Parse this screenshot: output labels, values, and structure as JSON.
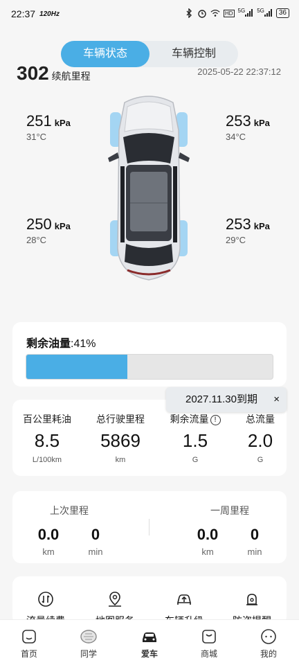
{
  "status_bar": {
    "time": "22:37",
    "refresh_rate": "120Hz",
    "network_1": "5G",
    "network_2": "5G",
    "battery": "36"
  },
  "tabs": [
    {
      "label": "车辆状态",
      "active": true
    },
    {
      "label": "车辆控制",
      "active": false
    }
  ],
  "header": {
    "range_value_partial": "302",
    "range_label": "续航里程",
    "timestamp": "2025-05-22 22:37:12"
  },
  "tires": {
    "front_left": {
      "pressure": "251",
      "unit": "kPa",
      "temp": "31°C"
    },
    "front_right": {
      "pressure": "253",
      "unit": "kPa",
      "temp": "34°C"
    },
    "rear_left": {
      "pressure": "250",
      "unit": "kPa",
      "temp": "28°C"
    },
    "rear_right": {
      "pressure": "253",
      "unit": "kPa",
      "temp": "29°C"
    }
  },
  "fuel": {
    "label": "剩余油量",
    "value": ":41%",
    "percent": 41,
    "color": "#4aaee5"
  },
  "expiry_badge": {
    "text": "2027.11.30到期",
    "close": "×"
  },
  "stats": [
    {
      "label": "百公里耗油",
      "value": "8.5",
      "unit": "L/100km"
    },
    {
      "label": "总行驶里程",
      "value": "5869",
      "unit": "km"
    },
    {
      "label": "剩余流量",
      "value": "1.5",
      "unit": "G",
      "info": "!"
    },
    {
      "label": "总流量",
      "value": "2.0",
      "unit": "G"
    }
  ],
  "mileage": {
    "last": {
      "title": "上次里程",
      "distance": "0.0",
      "distance_unit": "km",
      "time": "0",
      "time_unit": "min"
    },
    "week": {
      "title": "一周里程",
      "distance": "0.0",
      "distance_unit": "km",
      "time": "0",
      "time_unit": "min"
    }
  },
  "services": [
    {
      "name": "流量续费",
      "icon": "data-renew-icon"
    },
    {
      "name": "地图服务",
      "icon": "map-pin-icon"
    },
    {
      "name": "车辆升级",
      "icon": "car-upgrade-icon"
    },
    {
      "name": "防盗提醒",
      "icon": "alarm-icon"
    }
  ],
  "bottom_nav": [
    {
      "label": "首页",
      "icon": "home-icon",
      "active": false
    },
    {
      "label": "同学",
      "icon": "community-icon",
      "active": false
    },
    {
      "label": "爱车",
      "icon": "car-icon",
      "active": true
    },
    {
      "label": "商城",
      "icon": "shop-icon",
      "active": false
    },
    {
      "label": "我的",
      "icon": "profile-icon",
      "active": false
    }
  ]
}
